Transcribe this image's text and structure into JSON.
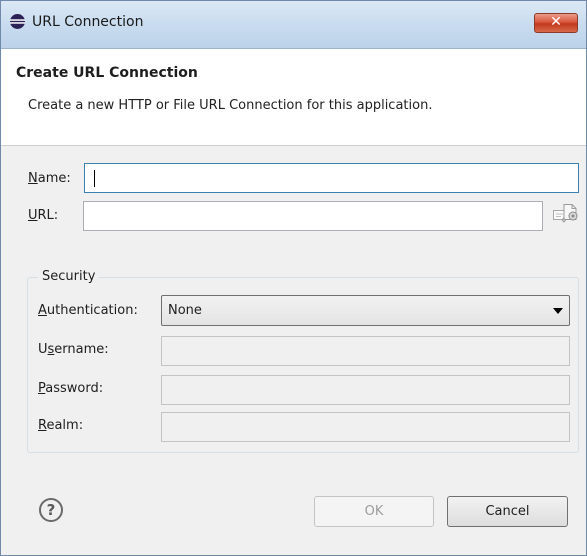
{
  "window": {
    "title": "URL Connection",
    "close_label": "✕"
  },
  "banner": {
    "title": "Create URL Connection",
    "description": "Create a new HTTP or File URL Connection for this application."
  },
  "form": {
    "name": {
      "label_accel": "N",
      "label_rest": "ame:",
      "value": ""
    },
    "url": {
      "label_accel": "U",
      "label_rest": "RL:",
      "value": ""
    }
  },
  "security": {
    "group_label": "Security",
    "authentication": {
      "label_accel": "A",
      "label_rest": "uthentication:",
      "selected": "None"
    },
    "username": {
      "label_pre": "U",
      "label_accel": "s",
      "label_rest": "ername:",
      "value": ""
    },
    "password": {
      "label_accel": "P",
      "label_rest": "assword:",
      "value": ""
    },
    "realm": {
      "label_accel": "R",
      "label_rest": "ealm:",
      "value": ""
    }
  },
  "footer": {
    "help_label": "?",
    "ok_label": "OK",
    "cancel_label": "Cancel"
  },
  "icons": {
    "app": "eclipse-icon",
    "edit": "edit-url-icon",
    "browse": "browse-file-icon",
    "help": "help-icon"
  }
}
